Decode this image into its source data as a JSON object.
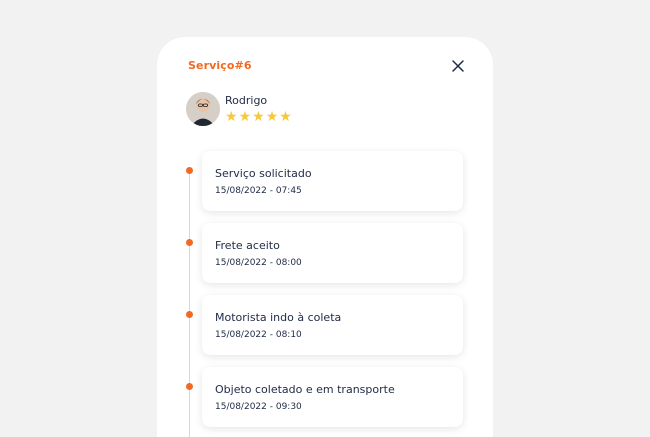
{
  "service": {
    "title": "Serviço#6"
  },
  "driver": {
    "name": "Rodrigo",
    "rating": 5,
    "stars": [
      "★",
      "★",
      "★",
      "★",
      "★"
    ]
  },
  "timeline": [
    {
      "title": "Serviço solicitado",
      "date": "15/08/2022 - 07:45"
    },
    {
      "title": "Frete aceito",
      "date": "15/08/2022 - 08:00"
    },
    {
      "title": "Motorista indo à coleta",
      "date": "15/08/2022 - 08:10"
    },
    {
      "title": "Objeto coletado e em transporte",
      "date": "15/08/2022 - 09:30"
    }
  ],
  "icons": {
    "close": "close-icon",
    "star": "star-icon"
  },
  "colors": {
    "accent": "#f26a21",
    "text": "#1e2a44",
    "star": "#f6c83c",
    "background": "#f2f2f2"
  }
}
